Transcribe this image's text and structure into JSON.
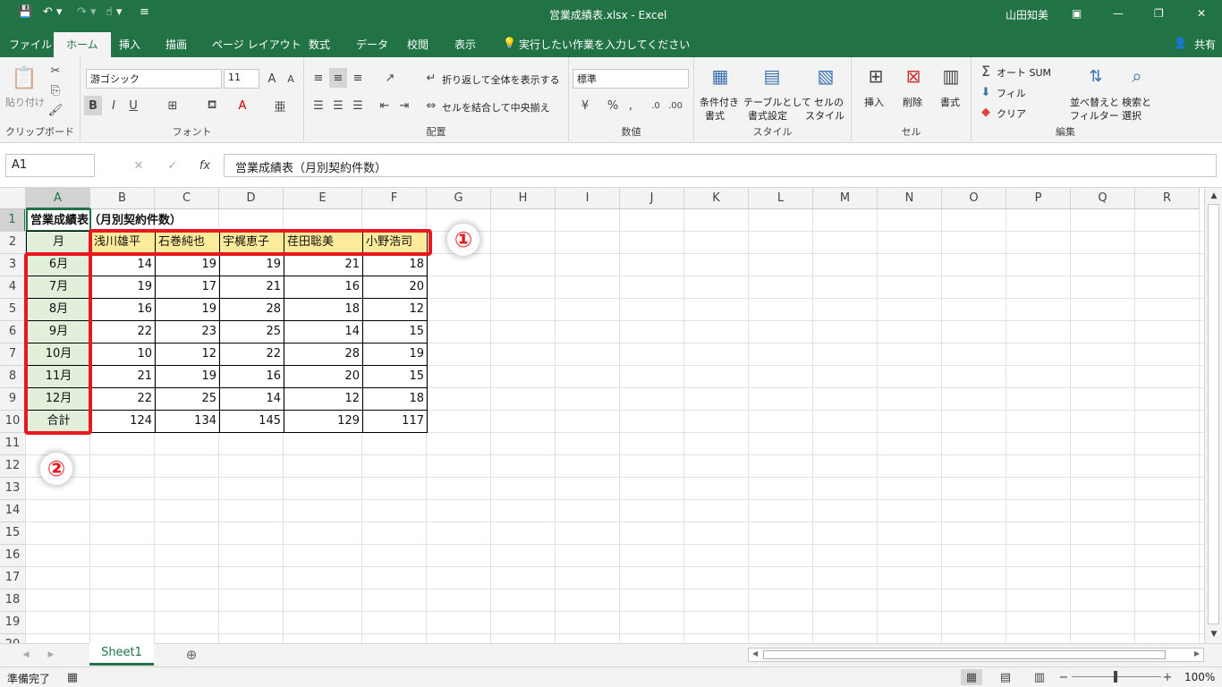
{
  "window": {
    "title": "営業成績表.xlsx - Excel",
    "user": "山田知美"
  },
  "menu": {
    "tabs": [
      "ファイル",
      "ホーム",
      "挿入",
      "描画",
      "ページ レイアウト",
      "数式",
      "データ",
      "校閲",
      "表示"
    ],
    "active": "ホーム",
    "tell_me": "実行したい作業を入力してください",
    "share": "共有"
  },
  "ribbon": {
    "clipboard": {
      "group": "クリップボード",
      "paste": "貼り付け"
    },
    "font": {
      "group": "フォント",
      "name": "游ゴシック",
      "size": "11",
      "bold": "B",
      "italic": "I",
      "underline": "U"
    },
    "alignment": {
      "group": "配置",
      "wrap": "折り返して全体を表示する",
      "merge": "セルを結合して中央揃え"
    },
    "number": {
      "group": "数値",
      "format": "標準"
    },
    "styles": {
      "group": "スタイル",
      "conditional": [
        "条件付き",
        "書式"
      ],
      "table": [
        "テーブルとして",
        "書式設定"
      ],
      "cell": [
        "セルの",
        "スタイル"
      ]
    },
    "cells": {
      "group": "セル",
      "insert": "挿入",
      "delete": "削除",
      "format": "書式"
    },
    "editing": {
      "group": "編集",
      "autosum": "オート SUM",
      "fill": "フィル",
      "clear": "クリア",
      "sort": [
        "並べ替えと",
        "フィルター"
      ],
      "find": [
        "検索と",
        "選択"
      ]
    }
  },
  "formula_bar": {
    "name_box": "A1",
    "fx": "fx",
    "value": "営業成績表（月別契約件数）"
  },
  "sheet": {
    "columns": [
      "A",
      "B",
      "C",
      "D",
      "E",
      "F",
      "G",
      "H",
      "I",
      "J",
      "K",
      "L",
      "M",
      "N",
      "O",
      "P",
      "Q",
      "R"
    ],
    "row_numbers": [
      "1",
      "2",
      "3",
      "4",
      "5",
      "6",
      "7",
      "8",
      "9",
      "10",
      "11",
      "12",
      "13",
      "14",
      "15",
      "16",
      "17",
      "18",
      "19",
      "20"
    ],
    "title": "営業成績表（月別契約件数）",
    "header_month": "月",
    "names": [
      "浅川雄平",
      "石巻純也",
      "宇梶恵子",
      "荏田聡美",
      "小野浩司"
    ],
    "rows": [
      {
        "month": "6月",
        "values": [
          "14",
          "19",
          "19",
          "21",
          "18"
        ]
      },
      {
        "month": "7月",
        "values": [
          "19",
          "17",
          "21",
          "16",
          "20"
        ]
      },
      {
        "month": "8月",
        "values": [
          "16",
          "19",
          "28",
          "18",
          "12"
        ]
      },
      {
        "month": "9月",
        "values": [
          "22",
          "23",
          "25",
          "14",
          "15"
        ]
      },
      {
        "month": "10月",
        "values": [
          "10",
          "12",
          "22",
          "28",
          "19"
        ]
      },
      {
        "month": "11月",
        "values": [
          "21",
          "19",
          "16",
          "20",
          "15"
        ]
      },
      {
        "month": "12月",
        "values": [
          "22",
          "25",
          "14",
          "12",
          "18"
        ]
      },
      {
        "month": "合計",
        "values": [
          "124",
          "134",
          "145",
          "129",
          "117"
        ]
      }
    ]
  },
  "annotations": {
    "badge1": "①",
    "badge2": "②"
  },
  "tabs": {
    "sheet1": "Sheet1",
    "add": "⊕"
  },
  "status": {
    "ready": "準備完了",
    "zoom": "100%"
  },
  "colors": {
    "accent": "#217346",
    "highlight_red": "#e8181e",
    "name_fill": "#ffeb9c",
    "month_fill": "#e2efda"
  }
}
